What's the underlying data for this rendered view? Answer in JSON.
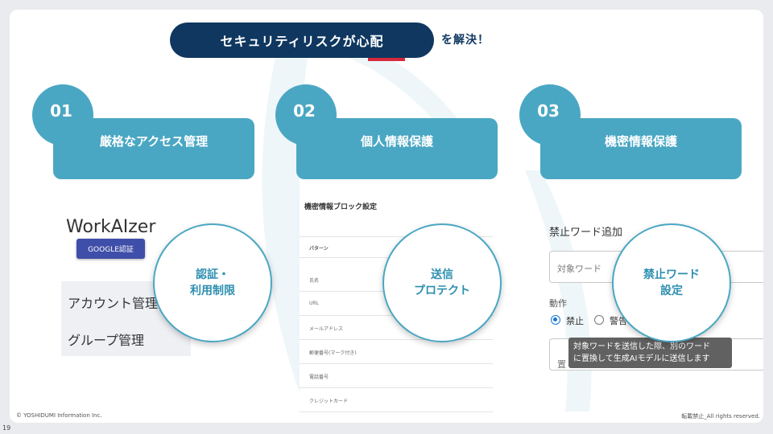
{
  "header": {
    "title": "セキュリティリスクが心配",
    "suffix": "を解決！"
  },
  "features": [
    {
      "number": "01",
      "title": "厳格なアクセス管理",
      "bubble_line1": "認証・",
      "bubble_line2": "利用制限"
    },
    {
      "number": "02",
      "title": "個人情報保護",
      "bubble_line1": "送信",
      "bubble_line2": "プロテクト"
    },
    {
      "number": "03",
      "title": "機密情報保護",
      "bubble_line1": "禁止ワード",
      "bubble_line2": "設定"
    }
  ],
  "screenshot1": {
    "logo": "WorkAIzer",
    "google_button": "GOOGLE認証",
    "menu": [
      "アカウント管理",
      "グループ管理"
    ]
  },
  "screenshot2": {
    "title": "機密情報ブロック設定",
    "column_header": "パターン",
    "rows": [
      "氏名",
      "URL",
      "メールアドレス",
      "郵便番号(マーク付き)",
      "電話番号",
      "クレジットカード"
    ]
  },
  "screenshot3": {
    "title": "禁止ワード追加",
    "target_placeholder": "対象ワード",
    "action_label": "動作",
    "options": [
      "禁止",
      "警告"
    ],
    "selected_option": "禁止",
    "second_field_partial": "置",
    "tooltip_line1": "対象ワードを送信した際、別のワード",
    "tooltip_line2": "に置換して生成AIモデルに送信します"
  },
  "footer": {
    "copyright": "© YOSHIDUMI Information  Inc.",
    "rights": "転載禁止_All rights reserved.",
    "page_number": "19"
  },
  "colors": {
    "navy": "#0f3760",
    "teal": "#4aa7c3",
    "red_accent": "#d6283c"
  }
}
